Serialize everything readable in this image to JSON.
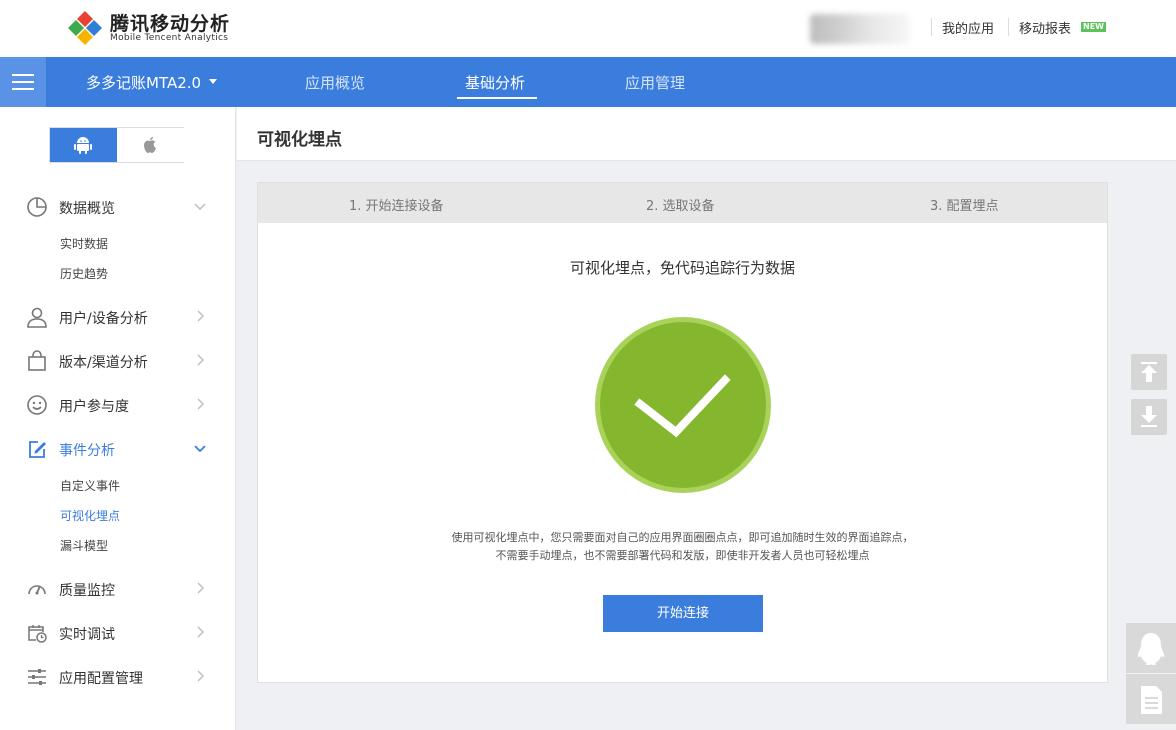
{
  "header": {
    "logo_title": "腾讯移动分析",
    "logo_subtitle": "Mobile Tencent Analytics",
    "my_apps": "我的应用",
    "mobile_report": "移动报表",
    "new_badge": "NEW"
  },
  "nav": {
    "app_name": "多多记账MTA2.0",
    "tabs": [
      {
        "label": "应用概览"
      },
      {
        "label": "基础分析"
      },
      {
        "label": "应用管理"
      }
    ],
    "active_tab": "基础分析"
  },
  "sidebar": {
    "os_options": [
      "android-icon",
      "apple-icon"
    ],
    "items": [
      {
        "label": "数据概览",
        "icon": "pie-chart-icon",
        "sub": [
          "实时数据",
          "历史趋势"
        ]
      },
      {
        "label": "用户/设备分析",
        "icon": "user-icon"
      },
      {
        "label": "版本/渠道分析",
        "icon": "shopping-bag-icon"
      },
      {
        "label": "用户参与度",
        "icon": "smile-icon"
      },
      {
        "label": "事件分析",
        "icon": "edit-icon",
        "sub": [
          "自定义事件",
          "可视化埋点",
          "漏斗模型"
        ]
      },
      {
        "label": "质量监控",
        "icon": "gauge-icon"
      },
      {
        "label": "实时调试",
        "icon": "calendar-clock-icon"
      },
      {
        "label": "应用配置管理",
        "icon": "sliders-icon"
      }
    ],
    "active_sub": "可视化埋点"
  },
  "page": {
    "title": "可视化埋点",
    "steps": [
      "1. 开始连接设备",
      "2. 选取设备",
      "3. 配置埋点"
    ],
    "heading": "可视化埋点，免代码追踪行为数据",
    "desc_line1": "使用可视化埋点中，您只需要面对自己的应用界面圈圈点点，即可追加随时生效的界面追踪点，",
    "desc_line2": "不需要手动埋点，也不需要部署代码和发版，即使非开发者人员也可轻松埋点",
    "start_button": "开始连接"
  },
  "colors": {
    "primary": "#3b7ddd",
    "success_green": "#85b72e",
    "badge_green": "#5cc35c"
  }
}
